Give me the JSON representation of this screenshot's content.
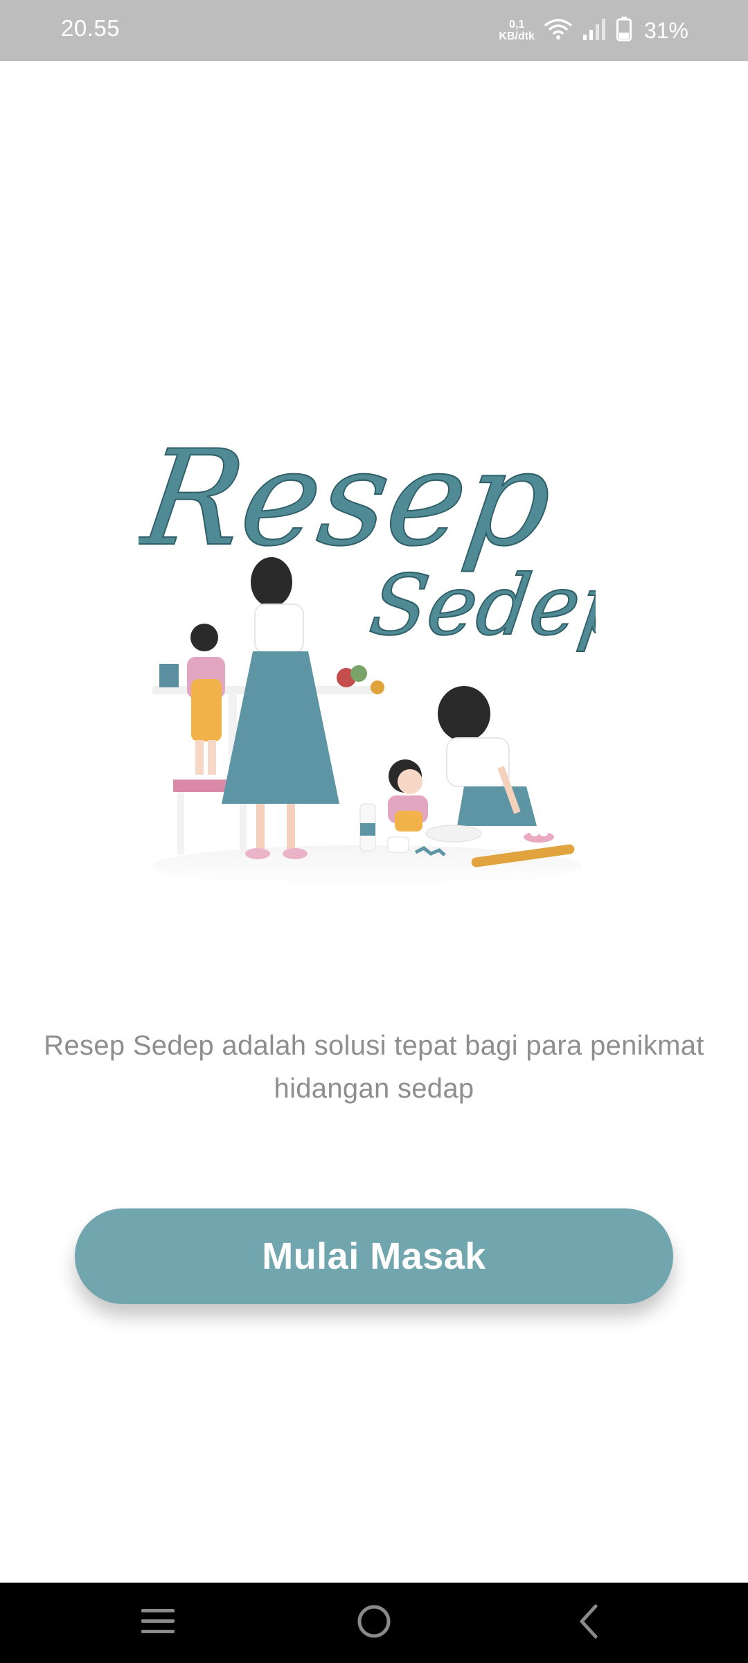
{
  "status_bar": {
    "time": "20.55",
    "net_speed_value": "0,1",
    "net_speed_unit": "KB/dtk",
    "battery_percent": "31%",
    "icons": [
      "wifi-icon",
      "signal-icon",
      "battery-icon"
    ]
  },
  "logo": {
    "line1": "Resep",
    "line2": "Sedep",
    "color": "#4f8a95"
  },
  "description": {
    "text": "Resep Sedep adalah solusi tepat bagi para penikmat hidangan sedap"
  },
  "cta": {
    "label": "Mulai Masak",
    "color": "#72a6ae"
  },
  "nav_bar": {
    "icons": [
      "menu-icon",
      "home-circle-icon",
      "back-chevron-icon"
    ]
  }
}
